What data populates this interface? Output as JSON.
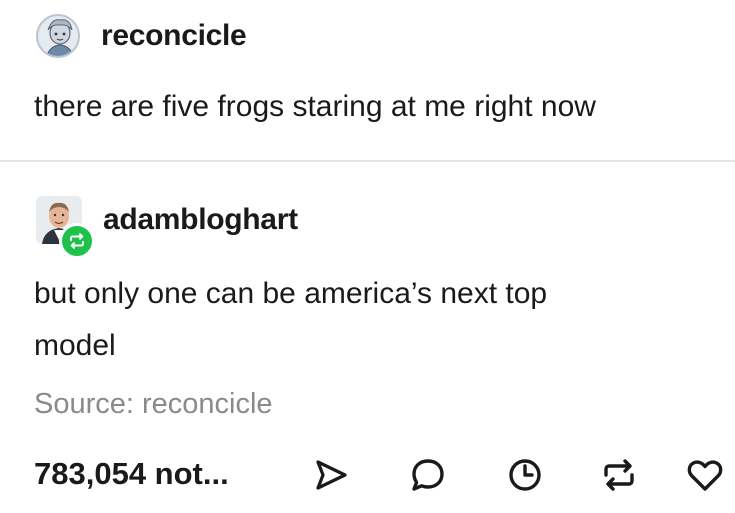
{
  "original_post": {
    "username": "reconcicle",
    "text": "there are five frogs staring at me right now"
  },
  "reblog": {
    "username": "adambloghart",
    "text_line1": "but only one can be america’s next top",
    "text_line2": "model"
  },
  "source": "Source: reconcicle",
  "footer": {
    "notes": "783,054 not...",
    "actions": [
      "share-icon",
      "reply-icon",
      "clock-icon",
      "reblog-icon",
      "like-icon"
    ]
  },
  "colors": {
    "reblog_badge": "#1ec24a",
    "source_text": "#8a8a8a",
    "divider": "#e5e5e5"
  }
}
